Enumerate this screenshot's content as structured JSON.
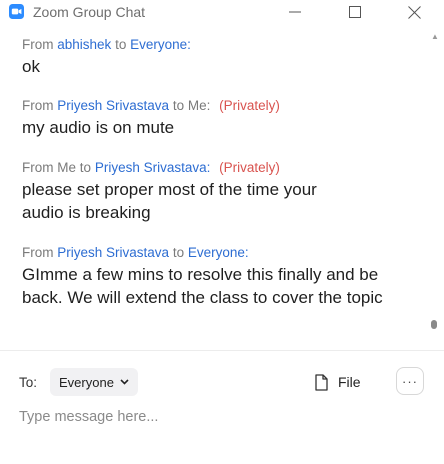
{
  "window": {
    "title": "Zoom Group Chat",
    "icons": {
      "app": "zoom-camera-icon",
      "minimize": "minimize-icon",
      "maximize": "maximize-icon",
      "close": "close-icon"
    }
  },
  "messages": [
    {
      "from_prefix": "From",
      "sender": "abhishek",
      "to_word": "to",
      "recipient": "Everyone:",
      "privately": "",
      "text": "ok"
    },
    {
      "from_prefix": "From",
      "sender": "Priyesh Srivastava",
      "to_word": "to",
      "recipient": "Me:",
      "privately": "(Privately)",
      "text": "my audio is on mute"
    },
    {
      "from_prefix": "From",
      "sender": "Me",
      "to_word": "to",
      "recipient": "Priyesh Srivastava:",
      "privately": "(Privately)",
      "text": "please set proper most of the time your audio is breaking"
    },
    {
      "from_prefix": "From",
      "sender": "Priyesh Srivastava",
      "to_word": "to",
      "recipient": "Everyone:",
      "privately": "",
      "text": "GImme a few mins to resolve this finally and be back. We will extend the class to cover the topic"
    }
  ],
  "composer": {
    "to_label": "To:",
    "recipient_selected": "Everyone",
    "file_label": "File",
    "more_label": "···",
    "placeholder": "Type message here...",
    "value": ""
  },
  "colors": {
    "name_link": "#2d6dd2",
    "private": "#d9534f",
    "meta": "#7a7a7a",
    "app_icon": "#2d8cff"
  }
}
